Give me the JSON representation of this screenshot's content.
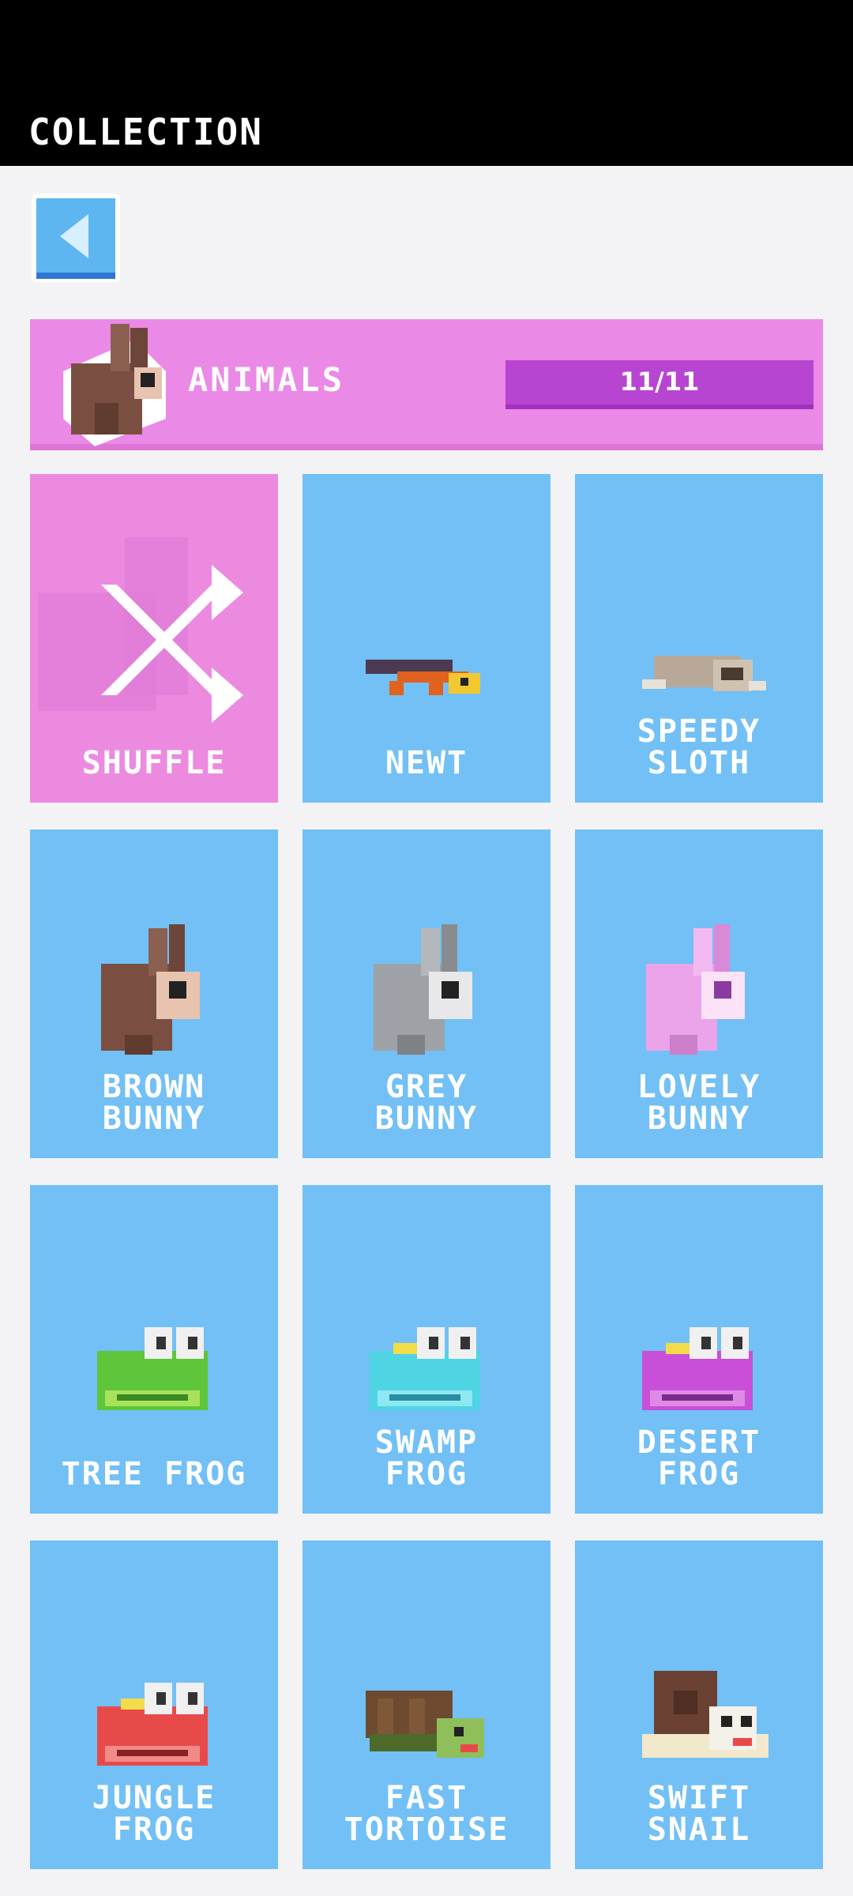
{
  "header": {
    "title": "COLLECTION"
  },
  "back": {
    "icon": "back-arrow-icon"
  },
  "category": {
    "label": "ANIMALS",
    "progress_text": "11/11",
    "progress_value": 1.0,
    "icon": "brown-bunny-icon"
  },
  "items": [
    {
      "label": "SHUFFLE",
      "icon": "shuffle-icon",
      "color": "#ec8ae0"
    },
    {
      "label": "NEWT",
      "icon": "newt-icon",
      "color": "#72c0f5"
    },
    {
      "label": "SPEEDY\nSLOTH",
      "icon": "sloth-icon",
      "color": "#72c0f5"
    },
    {
      "label": "BROWN\nBUNNY",
      "icon": "brown-bunny-icon",
      "color": "#72c0f5"
    },
    {
      "label": "GREY\nBUNNY",
      "icon": "grey-bunny-icon",
      "color": "#72c0f5"
    },
    {
      "label": "LOVELY\nBUNNY",
      "icon": "pink-bunny-icon",
      "color": "#72c0f5"
    },
    {
      "label": "TREE FROG",
      "icon": "green-frog-icon",
      "color": "#72c0f5"
    },
    {
      "label": "SWAMP\nFROG",
      "icon": "cyan-frog-icon",
      "color": "#72c0f5"
    },
    {
      "label": "DESERT\nFROG",
      "icon": "purple-frog-icon",
      "color": "#72c0f5"
    },
    {
      "label": "JUNGLE\nFROG",
      "icon": "red-frog-icon",
      "color": "#72c0f5"
    },
    {
      "label": "FAST\nTORTOISE",
      "icon": "tortoise-icon",
      "color": "#72c0f5"
    },
    {
      "label": "SWIFT\nSNAIL",
      "icon": "snail-icon",
      "color": "#72c0f5"
    }
  ]
}
